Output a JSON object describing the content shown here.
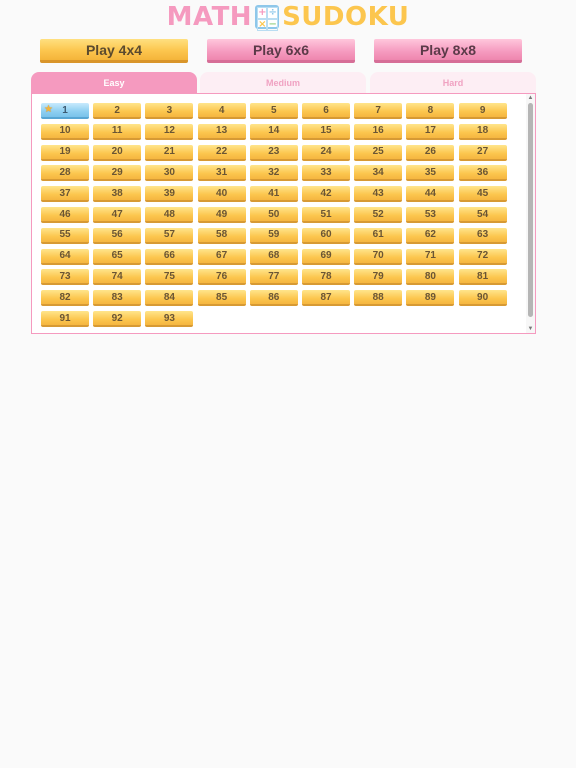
{
  "logo": {
    "math": "MATH",
    "sudoku": "SUDOKU",
    "grid_glyphs": [
      "+",
      "÷",
      "×",
      "−"
    ]
  },
  "play_buttons": [
    {
      "label": "Play 4x4"
    },
    {
      "label": "Play 6x6"
    },
    {
      "label": "Play 8x8"
    }
  ],
  "tabs": [
    {
      "label": "Easy",
      "active": true
    },
    {
      "label": "Medium",
      "active": false
    },
    {
      "label": "Hard",
      "active": false
    }
  ],
  "levels": {
    "total": 93,
    "columns": 9,
    "current": 1,
    "star_icon": "star-icon"
  },
  "colors": {
    "pink": "#f59abf",
    "yellow": "#fcc64e",
    "blue": "#8ecff1"
  }
}
